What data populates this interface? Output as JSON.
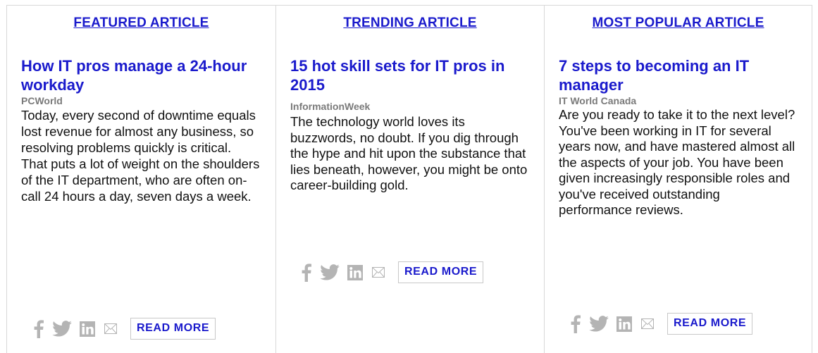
{
  "columns": [
    {
      "heading": "FEATURED ARTICLE",
      "title": "How IT pros manage a 24-hour workday",
      "source": "PCWorld",
      "summary": "Today, every second of downtime equals lost revenue for almost any business, so resolving problems quickly is critical. That puts a lot of weight on the shoulders of the IT department, who are often on-call 24 hours a day, seven days a week.",
      "read_more": "READ MORE"
    },
    {
      "heading": "TRENDING ARTICLE",
      "title": "15 hot skill sets for IT pros in 2015",
      "source": "InformationWeek",
      "summary": "The technology world loves its buzzwords, no doubt. If you dig through the hype and hit upon the substance that lies beneath, however, you might be onto career-building gold.",
      "read_more": "READ MORE"
    },
    {
      "heading": "MOST POPULAR ARTICLE",
      "title": "7 steps to becoming an IT manager",
      "source": "IT World Canada",
      "summary": "Are you ready to take it to the next level? You've been working in IT for several years now, and have mastered almost all the aspects of your job. You have been given increasingly responsible roles and you've received outstanding performance reviews.",
      "read_more": "READ MORE"
    }
  ],
  "share_icons": [
    "facebook-icon",
    "twitter-icon",
    "linkedin-icon",
    "mail-icon"
  ],
  "colors": {
    "link": "#1a1acc",
    "source": "#7a7a7a",
    "text": "#111111",
    "icon": "#b4b4b4",
    "border": "#d8d8d8"
  }
}
